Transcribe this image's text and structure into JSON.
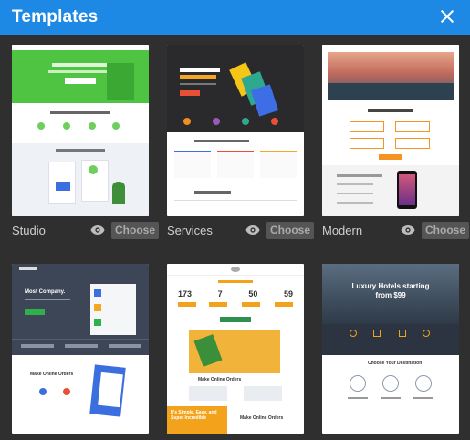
{
  "header": {
    "title": "Templates"
  },
  "templates": [
    {
      "name": "Studio",
      "choose_label": "Choose",
      "accent": "#3dba3e"
    },
    {
      "name": "Services",
      "choose_label": "Choose",
      "accent": "#f28b22"
    },
    {
      "name": "Modern",
      "choose_label": "Choose",
      "accent": "#f59324"
    },
    {
      "name": "",
      "choose_label": "",
      "accent": "#2fb04a"
    },
    {
      "name": "",
      "choose_label": "",
      "accent": "#f2a31b"
    },
    {
      "name": "",
      "choose_label": "",
      "accent": "#f2a31b"
    }
  ],
  "thumbs": {
    "t4_heading": "Most Company.",
    "t4_sub": "Make Online Orders",
    "t5_nums": [
      "173",
      "7",
      "50",
      "59"
    ],
    "t5_sub": "Make Online Orders",
    "t5_promo": "It's Simple, Easy, and Super Incredible",
    "t6_heading": "Luxury Hotels starting from $99",
    "t6_sub": "Choose Your Destination"
  },
  "colors": {
    "header": "#1e88e5",
    "background": "#2f2f30",
    "choose_bg": "#555555"
  },
  "icons": {
    "close": "close-icon",
    "preview": "eye-icon"
  }
}
